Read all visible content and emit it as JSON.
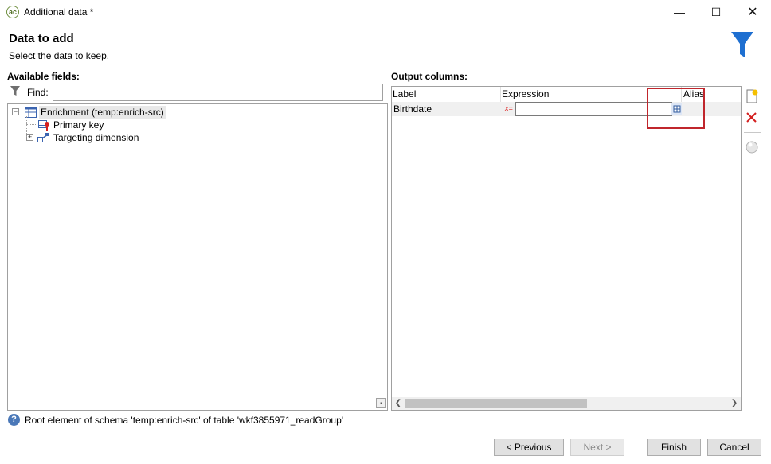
{
  "window": {
    "title": "Additional data *",
    "app_icon": "adobe-campaign-icon",
    "controls": {
      "minimize": "—",
      "maximize": "☐",
      "close": "✕"
    }
  },
  "header": {
    "title": "Data to add",
    "subtitle": "Select the data to keep.",
    "icon": "filter-funnel-icon"
  },
  "left_panel": {
    "label": "Available fields:",
    "find_label": "Find:",
    "find_value": "",
    "tree": [
      {
        "label": "Enrichment (temp:enrich-src)",
        "expander": "−",
        "icon": "table-icon"
      },
      {
        "label": "Primary key",
        "icon": "primary-key-icon"
      },
      {
        "label": "Targeting dimension",
        "expander": "+",
        "icon": "link-icon"
      }
    ]
  },
  "right_panel": {
    "label": "Output columns:",
    "columns": [
      "Label",
      "Expression",
      "Alias"
    ],
    "rows": [
      {
        "label": "Birthdate",
        "expression": "",
        "alias": ""
      }
    ],
    "expression_marker": "x="
  },
  "status": {
    "icon": "help-icon",
    "text": "Root element of schema 'temp:enrich-src' of table 'wkf3855971_readGroup'"
  },
  "buttons": {
    "previous": "< Previous",
    "next": "Next >",
    "finish": "Finish",
    "cancel": "Cancel"
  },
  "colors": {
    "accent_blue": "#1e6fd1",
    "highlight_red": "#c0262c",
    "row_selected": "#f0f0f0"
  }
}
